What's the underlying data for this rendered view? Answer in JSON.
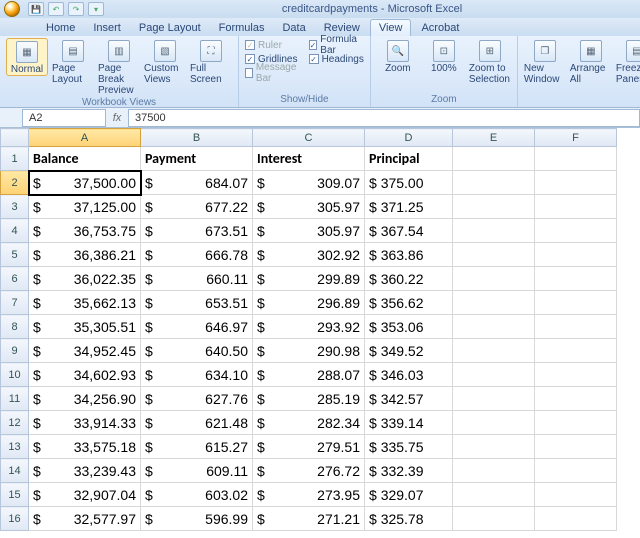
{
  "window": {
    "title": "creditcardpayments - Microsoft Excel"
  },
  "tabs": [
    "Home",
    "Insert",
    "Page Layout",
    "Formulas",
    "Data",
    "Review",
    "View",
    "Acrobat"
  ],
  "active_tab": "View",
  "ribbon": {
    "views": {
      "label": "Workbook Views",
      "normal": "Normal",
      "page_layout": "Page Layout",
      "page_break": "Page Break Preview",
      "custom": "Custom Views",
      "full": "Full Screen"
    },
    "showhide": {
      "label": "Show/Hide",
      "ruler": "Ruler",
      "gridlines": "Gridlines",
      "messagebar": "Message Bar",
      "formulabar": "Formula Bar",
      "headings": "Headings"
    },
    "zoom": {
      "label": "Zoom",
      "zoom": "Zoom",
      "p100": "100%",
      "sel": "Zoom to Selection"
    },
    "window_group": {
      "new": "New Window",
      "arrange": "Arrange All",
      "freeze": "Freeze Panes"
    }
  },
  "namebox": "A2",
  "formula": "37500",
  "columns": [
    "A",
    "B",
    "C",
    "D",
    "E",
    "F"
  ],
  "headers": [
    "Balance",
    "Payment",
    "Interest",
    "Principal"
  ],
  "chart_data": {
    "type": "table",
    "columns": [
      "Balance",
      "Payment",
      "Interest",
      "Principal"
    ],
    "rows": [
      {
        "Balance": "$ 37,500.00",
        "Payment": "$       684.07",
        "Interest": "$        309.07",
        "Principal": "$ 375.00"
      },
      {
        "Balance": "$ 37,125.00",
        "Payment": "$       677.22",
        "Interest": "$        305.97",
        "Principal": "$ 371.25"
      },
      {
        "Balance": "$ 36,753.75",
        "Payment": "$       673.51",
        "Interest": "$        305.97",
        "Principal": "$ 367.54"
      },
      {
        "Balance": "$ 36,386.21",
        "Payment": "$       666.78",
        "Interest": "$        302.92",
        "Principal": "$ 363.86"
      },
      {
        "Balance": "$ 36,022.35",
        "Payment": "$       660.11",
        "Interest": "$        299.89",
        "Principal": "$ 360.22"
      },
      {
        "Balance": "$ 35,662.13",
        "Payment": "$       653.51",
        "Interest": "$        296.89",
        "Principal": "$ 356.62"
      },
      {
        "Balance": "$ 35,305.51",
        "Payment": "$       646.97",
        "Interest": "$        293.92",
        "Principal": "$ 353.06"
      },
      {
        "Balance": "$ 34,952.45",
        "Payment": "$       640.50",
        "Interest": "$        290.98",
        "Principal": "$ 349.52"
      },
      {
        "Balance": "$ 34,602.93",
        "Payment": "$       634.10",
        "Interest": "$        288.07",
        "Principal": "$ 346.03"
      },
      {
        "Balance": "$ 34,256.90",
        "Payment": "$       627.76",
        "Interest": "$        285.19",
        "Principal": "$ 342.57"
      },
      {
        "Balance": "$ 33,914.33",
        "Payment": "$       621.48",
        "Interest": "$        282.34",
        "Principal": "$ 339.14"
      },
      {
        "Balance": "$ 33,575.18",
        "Payment": "$       615.27",
        "Interest": "$        279.51",
        "Principal": "$ 335.75"
      },
      {
        "Balance": "$ 33,239.43",
        "Payment": "$       609.11",
        "Interest": "$        276.72",
        "Principal": "$ 332.39"
      },
      {
        "Balance": "$ 32,907.04",
        "Payment": "$       603.02",
        "Interest": "$        273.95",
        "Principal": "$ 329.07"
      },
      {
        "Balance": "$ 32,577.97",
        "Payment": "$       596.99",
        "Interest": "$        271.21",
        "Principal": "$ 325.78"
      }
    ]
  }
}
